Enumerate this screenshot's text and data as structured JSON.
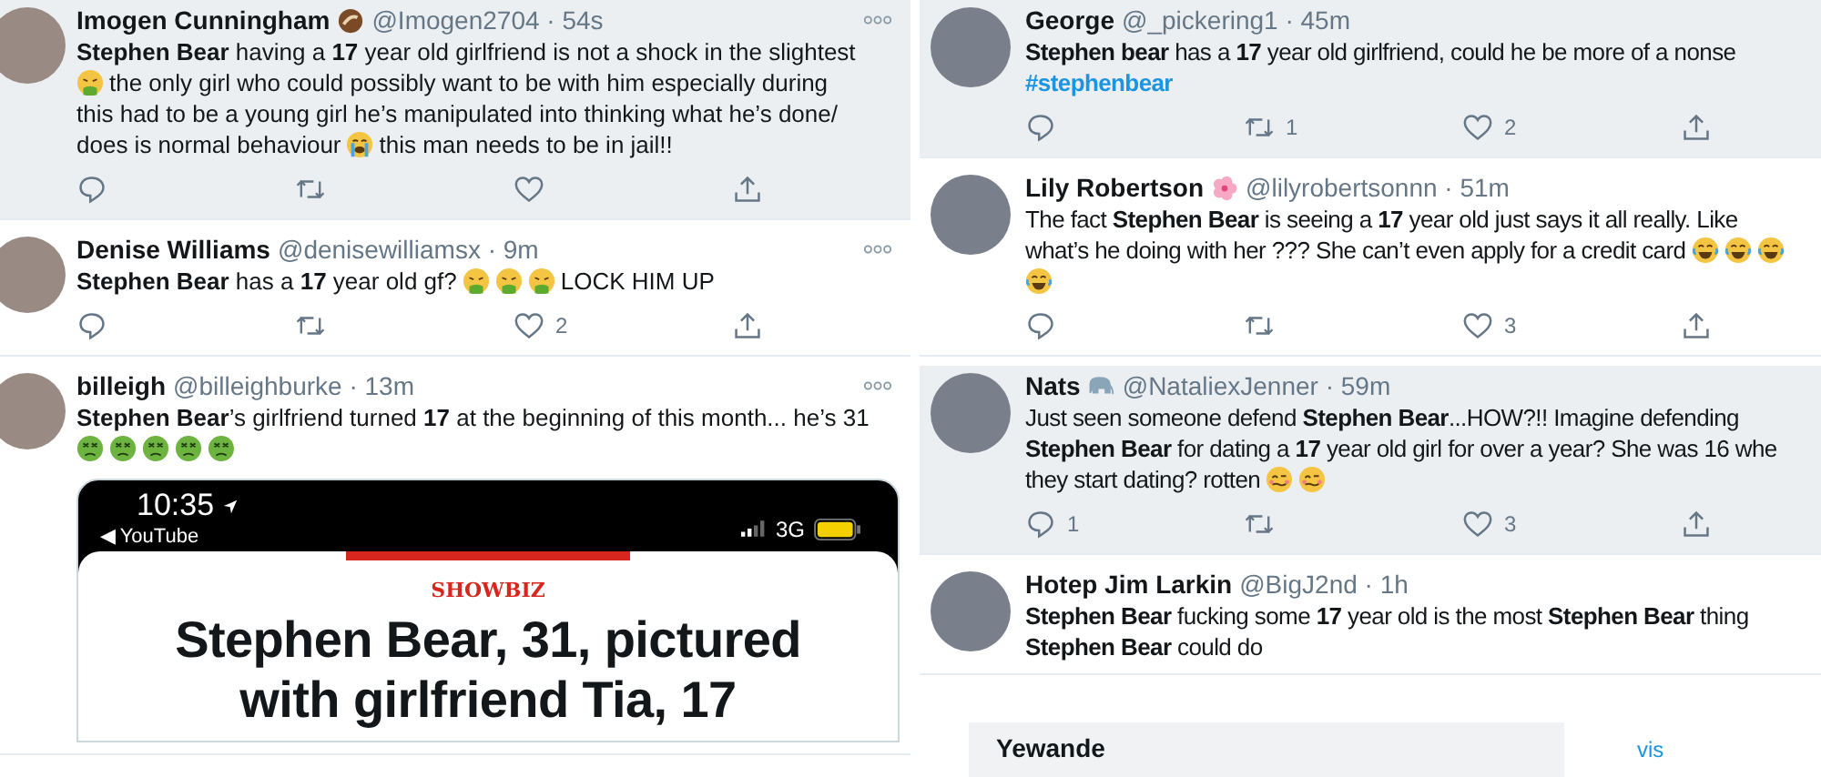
{
  "columns": [
    {
      "tweets": [
        {
          "name": "Imogen Cunningham",
          "name_icon": {
            "kind": "coconut"
          },
          "meta": "@Imogen2704 · 54s",
          "hovered": true,
          "more": true,
          "lines": [
            [
              {
                "kind": "text",
                "text": "**Stephen Bear** having a **17** year old girlfriend is not a shock in the slightest"
              }
            ],
            [
              {
                "kind": "vomiting-face"
              },
              {
                "kind": "text",
                "text": "the only girl who could possibly want to be with him especially during"
              }
            ],
            [
              {
                "kind": "text",
                "text": "this had to be a young girl he’s manipulated into thinking what he’s done/"
              }
            ],
            [
              {
                "kind": "text",
                "text": "does is normal behaviour"
              },
              {
                "kind": "crying-face"
              },
              {
                "kind": "text",
                "text": "this man needs to be in jail!!"
              }
            ]
          ],
          "actions": [
            {
              "kind": "reply"
            },
            {
              "kind": "retweet"
            },
            {
              "kind": "like"
            },
            {
              "kind": "share"
            }
          ]
        },
        {
          "name": "Denise Williams",
          "meta": "@denisewilliamsx · 9m",
          "hovered": false,
          "more": true,
          "lines": [
            [
              {
                "kind": "text",
                "text": "**Stephen Bear** has a **17** year old gf?"
              },
              {
                "kind": "vomiting-face"
              },
              {
                "kind": "vomiting-face"
              },
              {
                "kind": "vomiting-face"
              },
              {
                "kind": "text",
                "text": "LOCK HIM UP"
              }
            ]
          ],
          "actions": [
            {
              "kind": "reply"
            },
            {
              "kind": "retweet"
            },
            {
              "kind": "like",
              "count": "2"
            },
            {
              "kind": "share"
            }
          ]
        },
        {
          "name": "billeigh",
          "meta": "@billeighburke · 13m",
          "hovered": false,
          "more": true,
          "lines": [
            [
              {
                "kind": "text",
                "text": "**Stephen Bear**’s girlfriend turned **17** at the beginning of this month... he’s 31"
              }
            ],
            [
              {
                "kind": "sick-face"
              },
              {
                "kind": "sick-face"
              },
              {
                "kind": "sick-face"
              },
              {
                "kind": "sick-face"
              },
              {
                "kind": "sick-face"
              }
            ]
          ],
          "media": {
            "kind": "phone-screenshot",
            "time": "10:35",
            "back": "◀ YouTube",
            "network": "3G",
            "section": "SHOWBIZ",
            "headline": "Stephen Bear, 31, pictured with girlfriend Tia, 17"
          }
        }
      ]
    },
    {
      "tweets": [
        {
          "name": "George",
          "meta": "@_pickering1 · 45m",
          "hovered": true,
          "more": false,
          "lines": [
            [
              {
                "kind": "text",
                "text": "**Stephen bear** has a **17** year old girlfriend, could he be more of a nonse"
              }
            ],
            [
              {
                "kind": "hashtag",
                "text": "#stephenbear"
              }
            ]
          ],
          "actions": [
            {
              "kind": "reply"
            },
            {
              "kind": "retweet",
              "count": "1"
            },
            {
              "kind": "like",
              "count": "2"
            },
            {
              "kind": "share"
            }
          ]
        },
        {
          "name": "Lily Robertson",
          "name_icon": {
            "kind": "blossom"
          },
          "meta": "@lilyrobertsonnn · 51m",
          "hovered": false,
          "more": false,
          "lines": [
            [
              {
                "kind": "text",
                "text": "The fact **Stephen Bear** is seeing a **17** year old just says it all really. Like"
              }
            ],
            [
              {
                "kind": "text",
                "text": "what’s he doing with her ??? She can’t even apply for a credit card"
              },
              {
                "kind": "laughing-face"
              },
              {
                "kind": "laughing-face"
              },
              {
                "kind": "laughing-face"
              }
            ],
            [
              {
                "kind": "laughing-face"
              }
            ]
          ],
          "actions": [
            {
              "kind": "reply"
            },
            {
              "kind": "retweet"
            },
            {
              "kind": "like",
              "count": "3"
            },
            {
              "kind": "share"
            }
          ]
        },
        {
          "name": "Nats",
          "name_icon": {
            "kind": "elephant"
          },
          "meta": "@NataliexJenner · 59m",
          "hovered": true,
          "more": false,
          "lines": [
            [
              {
                "kind": "text",
                "text": "Just seen someone defend **Stephen Bear**...HOW?!! Imagine defending"
              }
            ],
            [
              {
                "kind": "text",
                "text": "**Stephen Bear** for dating a **17** year old girl for over a year? She was 16 whe"
              }
            ],
            [
              {
                "kind": "text",
                "text": "they start dating? rotten"
              },
              {
                "kind": "woozy-face"
              },
              {
                "kind": "woozy-face"
              }
            ]
          ],
          "actions": [
            {
              "kind": "reply",
              "count": "1"
            },
            {
              "kind": "retweet"
            },
            {
              "kind": "like",
              "count": "3"
            },
            {
              "kind": "share"
            }
          ]
        },
        {
          "name": "Hotep Jim Larkin",
          "meta": "@BigJ2nd · 1h",
          "hovered": false,
          "more": false,
          "lines": [
            [
              {
                "kind": "text",
                "text": "**Stephen Bear** fucking some **17** year old is the most **Stephen Bear** thing"
              }
            ],
            [
              {
                "kind": "text",
                "text": "**Stephen Bear** could do"
              }
            ]
          ]
        }
      ],
      "footer": {
        "title": "Yewande",
        "link": "vis"
      }
    }
  ]
}
